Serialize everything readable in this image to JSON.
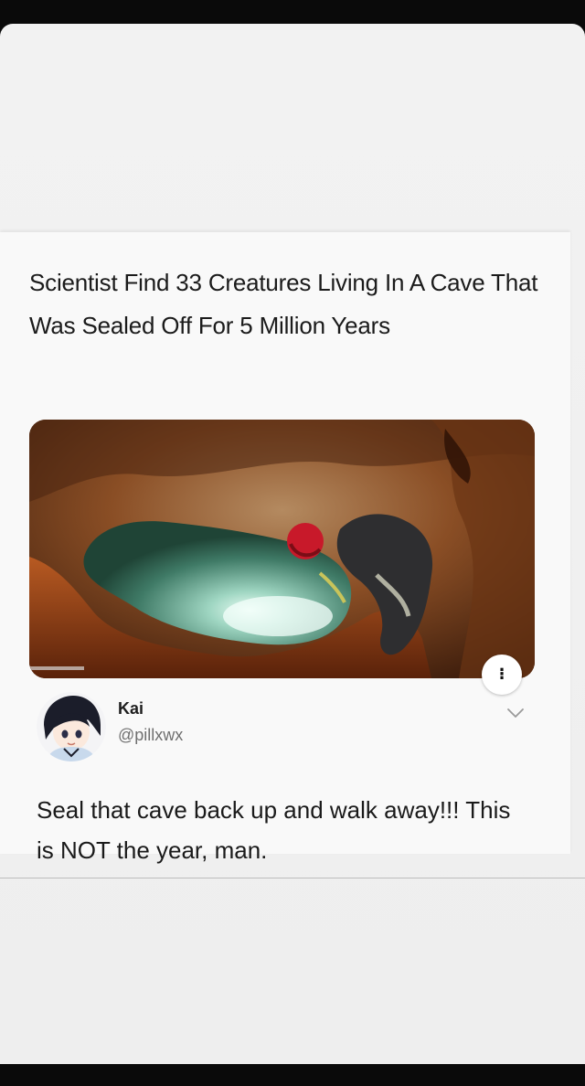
{
  "post": {
    "headline": "Scientist Find 33 Creatures Living In A Cave That Was Sealed Off For 5 Million Years",
    "image_icon": "cave-photo",
    "more_icon": "more-options-icon",
    "more_glyph": "⁝"
  },
  "tweet": {
    "avatar_icon": "avatar-illustration",
    "name": "Kai",
    "handle": "@pillxwx",
    "text": "Seal that cave back up and walk away!!! This is NOT the year, man.",
    "chevron_icon": "chevron-down-icon"
  }
}
